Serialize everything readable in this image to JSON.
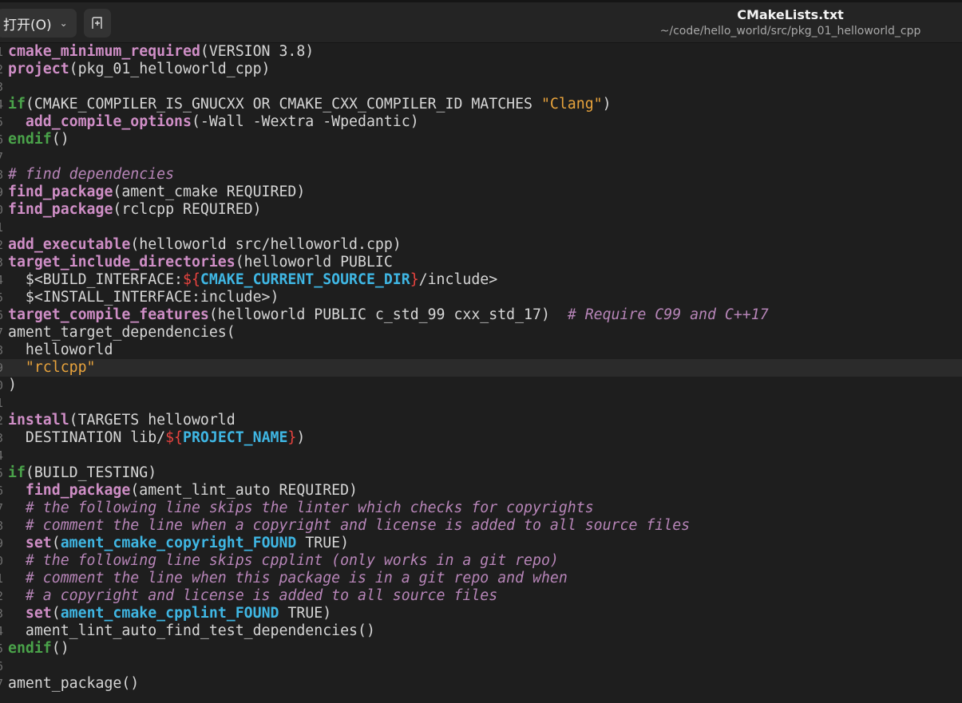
{
  "header": {
    "open_label": "打开(O)",
    "open_icon": "chevron-down-icon",
    "new_tab_icon": "new-document-icon",
    "title": "CMakeLists.txt",
    "subtitle": "~/code/hello_world/src/pkg_01_helloworld_cpp"
  },
  "colors": {
    "function": "#cf8ec6",
    "keyword": "#4aa34a",
    "variable": "#3fb6e3",
    "string": "#e8a33c",
    "comment": "#b785b8",
    "expansion": "#e8433f",
    "text": "#d6d6d6",
    "background": "#1e1e1e",
    "current_line": "#2b2b2b"
  },
  "editor": {
    "current_line": 19,
    "lines": [
      [
        [
          "f",
          "cmake_minimum_required"
        ],
        [
          "p",
          "(VERSION 3.8)"
        ]
      ],
      [
        [
          "f",
          "project"
        ],
        [
          "p",
          "(pkg_01_helloworld_cpp)"
        ]
      ],
      [],
      [
        [
          "k",
          "if"
        ],
        [
          "p",
          "(CMAKE_COMPILER_IS_GNUCXX OR CMAKE_CXX_COMPILER_ID MATCHES "
        ],
        [
          "s",
          "\"Clang\""
        ],
        [
          "p",
          ")"
        ]
      ],
      [
        [
          "p",
          "  "
        ],
        [
          "f",
          "add_compile_options"
        ],
        [
          "p",
          "(-Wall -Wextra -Wpedantic)"
        ]
      ],
      [
        [
          "k",
          "endif"
        ],
        [
          "p",
          "()"
        ]
      ],
      [],
      [
        [
          "c",
          "# find dependencies"
        ]
      ],
      [
        [
          "f",
          "find_package"
        ],
        [
          "p",
          "(ament_cmake REQUIRED)"
        ]
      ],
      [
        [
          "f",
          "find_package"
        ],
        [
          "p",
          "(rclcpp REQUIRED)"
        ]
      ],
      [],
      [
        [
          "f",
          "add_executable"
        ],
        [
          "p",
          "(helloworld src/helloworld.cpp)"
        ]
      ],
      [
        [
          "f",
          "target_include_directories"
        ],
        [
          "p",
          "(helloworld PUBLIC"
        ]
      ],
      [
        [
          "p",
          "  $<BUILD_INTERFACE:"
        ],
        [
          "r",
          "${"
        ],
        [
          "v",
          "CMAKE_CURRENT_SOURCE_DIR"
        ],
        [
          "r",
          "}"
        ],
        [
          "p",
          "/include>"
        ]
      ],
      [
        [
          "p",
          "  $<INSTALL_INTERFACE:include>)"
        ]
      ],
      [
        [
          "f",
          "target_compile_features"
        ],
        [
          "p",
          "(helloworld PUBLIC c_std_99 cxx_std_17)  "
        ],
        [
          "c",
          "# Require C99 and C++17"
        ]
      ],
      [
        [
          "p",
          "ament_target_dependencies("
        ]
      ],
      [
        [
          "p",
          "  helloworld"
        ]
      ],
      [
        [
          "p",
          "  "
        ],
        [
          "s",
          "\"rclcpp\""
        ]
      ],
      [
        [
          "p",
          ")"
        ]
      ],
      [],
      [
        [
          "f",
          "install"
        ],
        [
          "p",
          "(TARGETS helloworld"
        ]
      ],
      [
        [
          "p",
          "  DESTINATION lib/"
        ],
        [
          "r",
          "${"
        ],
        [
          "v",
          "PROJECT_NAME"
        ],
        [
          "r",
          "}"
        ],
        [
          "p",
          ")"
        ]
      ],
      [],
      [
        [
          "k",
          "if"
        ],
        [
          "p",
          "(BUILD_TESTING)"
        ]
      ],
      [
        [
          "p",
          "  "
        ],
        [
          "f",
          "find_package"
        ],
        [
          "p",
          "(ament_lint_auto REQUIRED)"
        ]
      ],
      [
        [
          "p",
          "  "
        ],
        [
          "c",
          "# the following line skips the linter which checks for copyrights"
        ]
      ],
      [
        [
          "p",
          "  "
        ],
        [
          "c",
          "# comment the line when a copyright and license is added to all source files"
        ]
      ],
      [
        [
          "p",
          "  "
        ],
        [
          "f",
          "set"
        ],
        [
          "p",
          "("
        ],
        [
          "v",
          "ament_cmake_copyright_FOUND"
        ],
        [
          "p",
          " TRUE)"
        ]
      ],
      [
        [
          "p",
          "  "
        ],
        [
          "c",
          "# the following line skips cpplint (only works in a git repo)"
        ]
      ],
      [
        [
          "p",
          "  "
        ],
        [
          "c",
          "# comment the line when this package is in a git repo and when"
        ]
      ],
      [
        [
          "p",
          "  "
        ],
        [
          "c",
          "# a copyright and license is added to all source files"
        ]
      ],
      [
        [
          "p",
          "  "
        ],
        [
          "f",
          "set"
        ],
        [
          "p",
          "("
        ],
        [
          "v",
          "ament_cmake_cpplint_FOUND"
        ],
        [
          "p",
          " TRUE)"
        ]
      ],
      [
        [
          "p",
          "  ament_lint_auto_find_test_dependencies()"
        ]
      ],
      [
        [
          "k",
          "endif"
        ],
        [
          "p",
          "()"
        ]
      ],
      [],
      [
        [
          "p",
          "ament_package()"
        ]
      ]
    ]
  }
}
